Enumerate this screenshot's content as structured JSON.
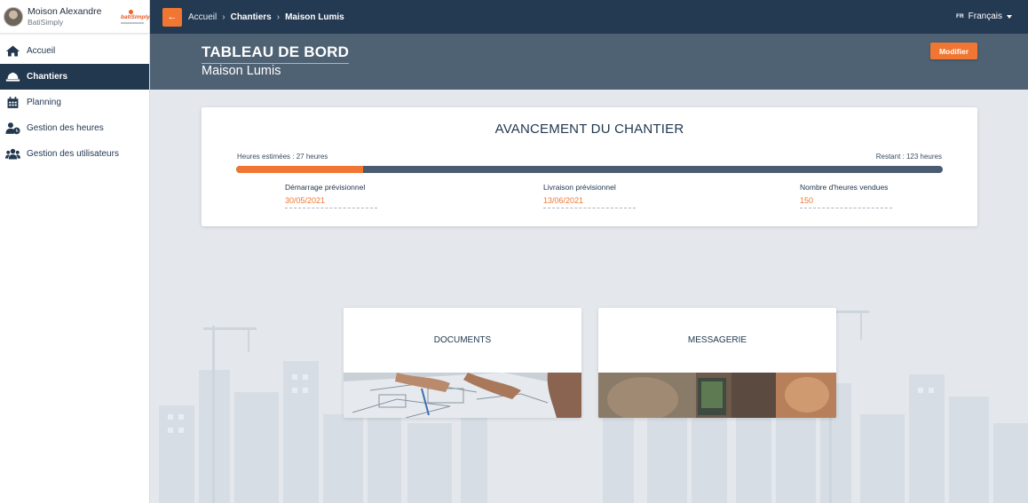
{
  "user": {
    "name": "Moison Alexandre",
    "company": "BatiSimply",
    "logo_text": "batiSimply"
  },
  "sidebar": {
    "items": [
      {
        "label": "Accueil",
        "icon": "home-icon"
      },
      {
        "label": "Chantiers",
        "icon": "hard-hat-icon",
        "active": true
      },
      {
        "label": "Planning",
        "icon": "calendar-icon"
      },
      {
        "label": "Gestion des heures",
        "icon": "user-clock-icon"
      },
      {
        "label": "Gestion des utilisateurs",
        "icon": "users-icon"
      }
    ]
  },
  "topbar": {
    "back_icon": "arrow-left-icon",
    "back_glyph": "←",
    "breadcrumb": [
      "Accueil",
      "Chantiers",
      "Maison Lumis"
    ],
    "separator": "›",
    "lang_code": "FR",
    "lang_label": "Français"
  },
  "header": {
    "title": "TABLEAU DE BORD",
    "subtitle": "Maison Lumis",
    "modify_label": "Modifier"
  },
  "progress": {
    "title": "AVANCEMENT DU CHANTIER",
    "estimated_label": "Heures estimées : 27 heures",
    "remaining_label": "Restant : 123 heures",
    "fraction": 0.18,
    "fields": [
      {
        "label": "Démarrage prévisionnel",
        "value": "30/05/2021"
      },
      {
        "label": "Livraison prévisionnel",
        "value": "13/06/2021"
      },
      {
        "label": "Nombre d'heures vendues",
        "value": "150"
      }
    ]
  },
  "tiles": [
    {
      "title": "DOCUMENTS"
    },
    {
      "title": "MESSAGERIE"
    }
  ],
  "colors": {
    "accent": "#f07632",
    "navy": "#243a52",
    "header": "#4f6274",
    "background": "#e4e8ec"
  }
}
